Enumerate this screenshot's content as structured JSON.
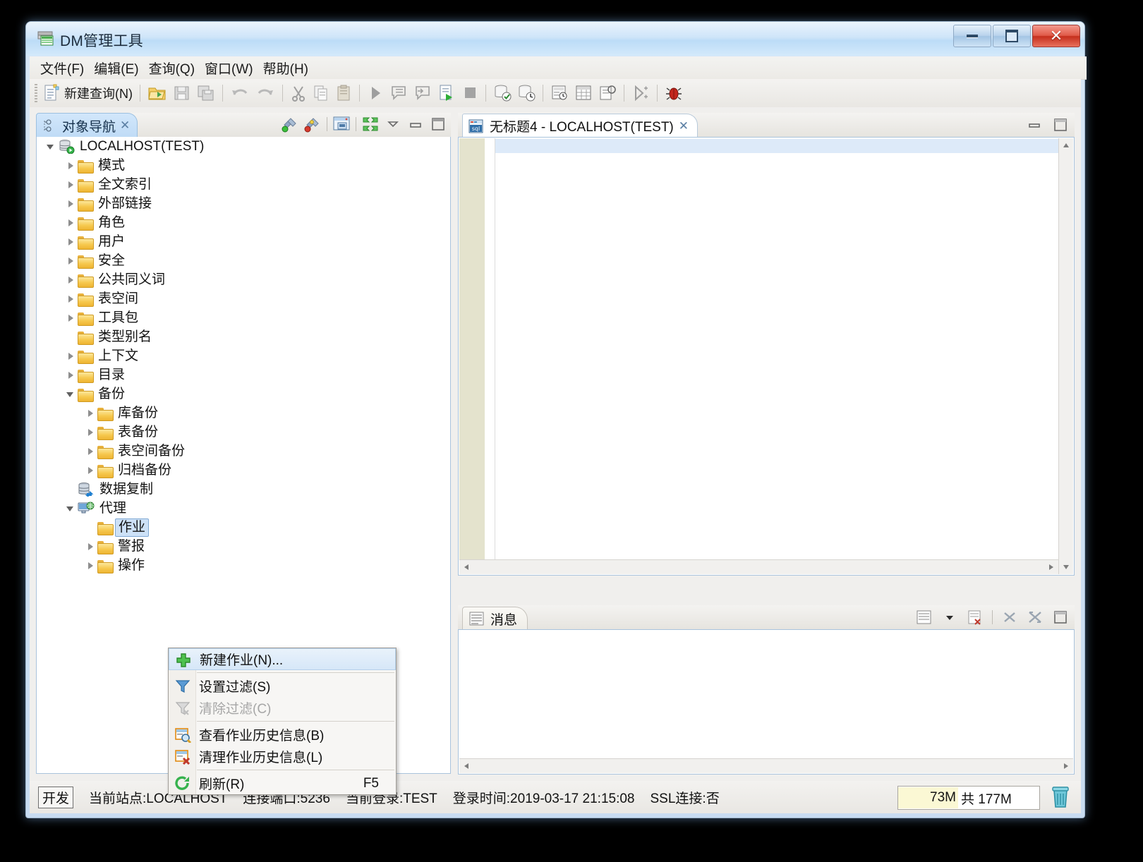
{
  "window": {
    "title": "DM管理工具",
    "icon": "app-icon",
    "controls": {
      "minimize": "–",
      "maximize": "□",
      "close": "✕"
    }
  },
  "menubar": {
    "items": [
      {
        "label": "文件(F)",
        "name": "menu-file"
      },
      {
        "label": "编辑(E)",
        "name": "menu-edit"
      },
      {
        "label": "查询(Q)",
        "name": "menu-query"
      },
      {
        "label": "窗口(W)",
        "name": "menu-window"
      },
      {
        "label": "帮助(H)",
        "name": "menu-help"
      }
    ]
  },
  "toolbar": {
    "new_query_label": "新建查询(N)",
    "buttons": [
      "new-query",
      "open-file",
      "save",
      "save-all",
      "undo",
      "redo",
      "cut",
      "copy",
      "paste",
      "execute",
      "execute-comment",
      "execute-uncomment",
      "execute-script",
      "stop",
      "commit",
      "rollback",
      "history",
      "grid",
      "explain",
      "trace",
      "debug"
    ]
  },
  "left_panel": {
    "tab_title": "对象导航",
    "tab_close": "✕",
    "tools": [
      "connect-icon",
      "disconnect-icon",
      "new-window-icon",
      "collapse-all-icon",
      "view-menu-icon",
      "minimize-icon",
      "maximize-icon"
    ],
    "tree": [
      {
        "label": "LOCALHOST(TEST)",
        "indent": 0,
        "arrow": "open",
        "icon": "server-icon"
      },
      {
        "label": "模式",
        "indent": 1,
        "arrow": "closed",
        "icon": "folder-icon"
      },
      {
        "label": "全文索引",
        "indent": 1,
        "arrow": "closed",
        "icon": "folder-icon"
      },
      {
        "label": "外部链接",
        "indent": 1,
        "arrow": "closed",
        "icon": "folder-icon"
      },
      {
        "label": "角色",
        "indent": 1,
        "arrow": "closed",
        "icon": "folder-icon"
      },
      {
        "label": "用户",
        "indent": 1,
        "arrow": "closed",
        "icon": "folder-icon"
      },
      {
        "label": "安全",
        "indent": 1,
        "arrow": "closed",
        "icon": "folder-icon"
      },
      {
        "label": "公共同义词",
        "indent": 1,
        "arrow": "closed",
        "icon": "folder-icon"
      },
      {
        "label": "表空间",
        "indent": 1,
        "arrow": "closed",
        "icon": "folder-icon"
      },
      {
        "label": "工具包",
        "indent": 1,
        "arrow": "closed",
        "icon": "folder-icon"
      },
      {
        "label": "类型别名",
        "indent": 1,
        "arrow": "none",
        "icon": "folder-icon"
      },
      {
        "label": "上下文",
        "indent": 1,
        "arrow": "closed",
        "icon": "folder-icon"
      },
      {
        "label": "目录",
        "indent": 1,
        "arrow": "closed",
        "icon": "folder-icon"
      },
      {
        "label": "备份",
        "indent": 1,
        "arrow": "open",
        "icon": "folder-icon"
      },
      {
        "label": "库备份",
        "indent": 2,
        "arrow": "closed",
        "icon": "folder-icon"
      },
      {
        "label": "表备份",
        "indent": 2,
        "arrow": "closed",
        "icon": "folder-icon"
      },
      {
        "label": "表空间备份",
        "indent": 2,
        "arrow": "closed",
        "icon": "folder-icon"
      },
      {
        "label": "归档备份",
        "indent": 2,
        "arrow": "closed",
        "icon": "folder-icon"
      },
      {
        "label": "数据复制",
        "indent": 1,
        "arrow": "none",
        "icon": "replication-icon"
      },
      {
        "label": "代理",
        "indent": 1,
        "arrow": "open",
        "icon": "agent-icon"
      },
      {
        "label": "作业",
        "indent": 2,
        "arrow": "none",
        "icon": "folder-icon",
        "selected": true
      },
      {
        "label": "警报",
        "indent": 2,
        "arrow": "closed",
        "icon": "folder-icon"
      },
      {
        "label": "操作",
        "indent": 2,
        "arrow": "closed",
        "icon": "folder-icon"
      }
    ]
  },
  "context_menu": {
    "items": [
      {
        "label": "新建作业(N)...",
        "icon": "plus-icon",
        "highlighted": true,
        "disabled": false,
        "accel": ""
      },
      {
        "label": "设置过滤(S)",
        "icon": "filter-icon",
        "highlighted": false,
        "disabled": false,
        "accel": ""
      },
      {
        "label": "清除过滤(C)",
        "icon": "filter-clear-icon",
        "highlighted": false,
        "disabled": true,
        "accel": ""
      },
      {
        "label": "查看作业历史信息(B)",
        "icon": "history-view-icon",
        "highlighted": false,
        "disabled": false,
        "accel": ""
      },
      {
        "label": "清理作业历史信息(L)",
        "icon": "history-clear-icon",
        "highlighted": false,
        "disabled": false,
        "accel": ""
      },
      {
        "label": "刷新(R)",
        "icon": "refresh-icon",
        "highlighted": false,
        "disabled": false,
        "accel": "F5"
      }
    ]
  },
  "editor": {
    "tab_title": "无标题4 - LOCALHOST(TEST)",
    "tab_icon": "sql-icon",
    "tab_close": "✕",
    "content": "",
    "tools": [
      "minimize-icon",
      "maximize-icon"
    ]
  },
  "messages": {
    "tab_title": "消息",
    "tab_icon": "message-icon",
    "content": "",
    "tools": [
      "select-view-icon",
      "dropdown-icon",
      "clear-icon",
      "close-icon",
      "detach-icon",
      "maximize-icon"
    ]
  },
  "statusbar": {
    "badge": "开发",
    "site": "当前站点:LOCALHOST",
    "port": "连接端口:5236",
    "login": "当前登录:TEST",
    "login_time": "登录时间:2019-03-17 21:15:08",
    "ssl": "SSL连接:否",
    "memory_used": "73M",
    "memory_total": "共 177M",
    "memory_percent": 41,
    "trash_icon": "trash-icon"
  },
  "colors": {
    "accent": "#cde1f7",
    "folder": "#f6c84e",
    "titlebar": "#cfe5f9",
    "close_button": "#c52e1c",
    "memory_fill": "#fbf8d4",
    "gutter": "#e4e3cd"
  }
}
